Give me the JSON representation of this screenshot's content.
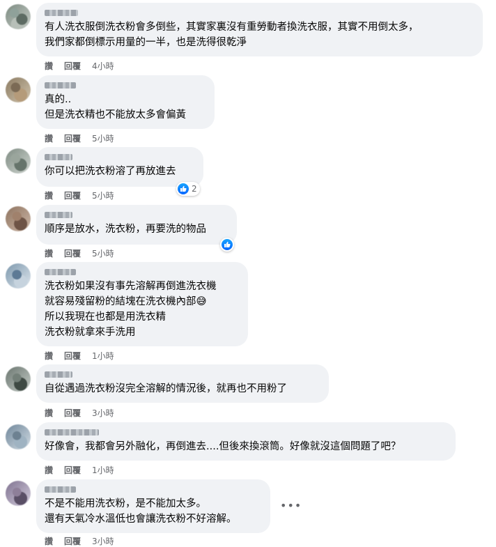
{
  "comments": [
    {
      "text": "有人洗衣服倒洗衣粉會多倒些，其實家裏沒有重勞動者換洗衣服，其實不用倒太多，\n我們家都倒標示用量的一半，也是洗得很乾淨",
      "like": "讚",
      "reply": "回覆",
      "time": "4小時"
    },
    {
      "text": "真的..\n但是洗衣精也不能放太多會偏黃",
      "like": "讚",
      "reply": "回覆",
      "time": "5小時"
    },
    {
      "text": "你可以把洗衣粉溶了再放進去",
      "like": "讚",
      "reply": "回覆",
      "time": "5小時",
      "reaction_count": "2"
    },
    {
      "text": "順序是放水，洗衣粉，再要洗的物品",
      "like": "讚",
      "reply": "回覆",
      "time": "5小時"
    },
    {
      "text": "洗衣粉如果沒有事先溶解再倒進洗衣機\n就容易殘留粉的結塊在洗衣機內部😅\n所以我現在也都是用洗衣精\n洗衣粉就拿來手洗用",
      "like": "讚",
      "reply": "回覆",
      "time": "1小時"
    },
    {
      "text": "自從遇過洗衣粉沒完全溶解的情況後，就再也不用粉了",
      "like": "讚",
      "reply": "回覆",
      "time": "3小時"
    },
    {
      "text": "好像會，我都會另外融化，再倒進去....但後來換滾筒。好像就沒這個問題了吧？",
      "like": "讚",
      "reply": "回覆",
      "time": "1小時"
    },
    {
      "text": "不是不能用洗衣粉，是不能加太多。\n還有天氣冷水溫低也會讓洗衣粉不好溶解。",
      "like": "讚",
      "reply": "回覆",
      "time": "3小時"
    }
  ],
  "more_options": "•••",
  "colors": {
    "bubble": "#f0f2f5",
    "meta": "#65676b",
    "like_blue": "#0866ff"
  }
}
